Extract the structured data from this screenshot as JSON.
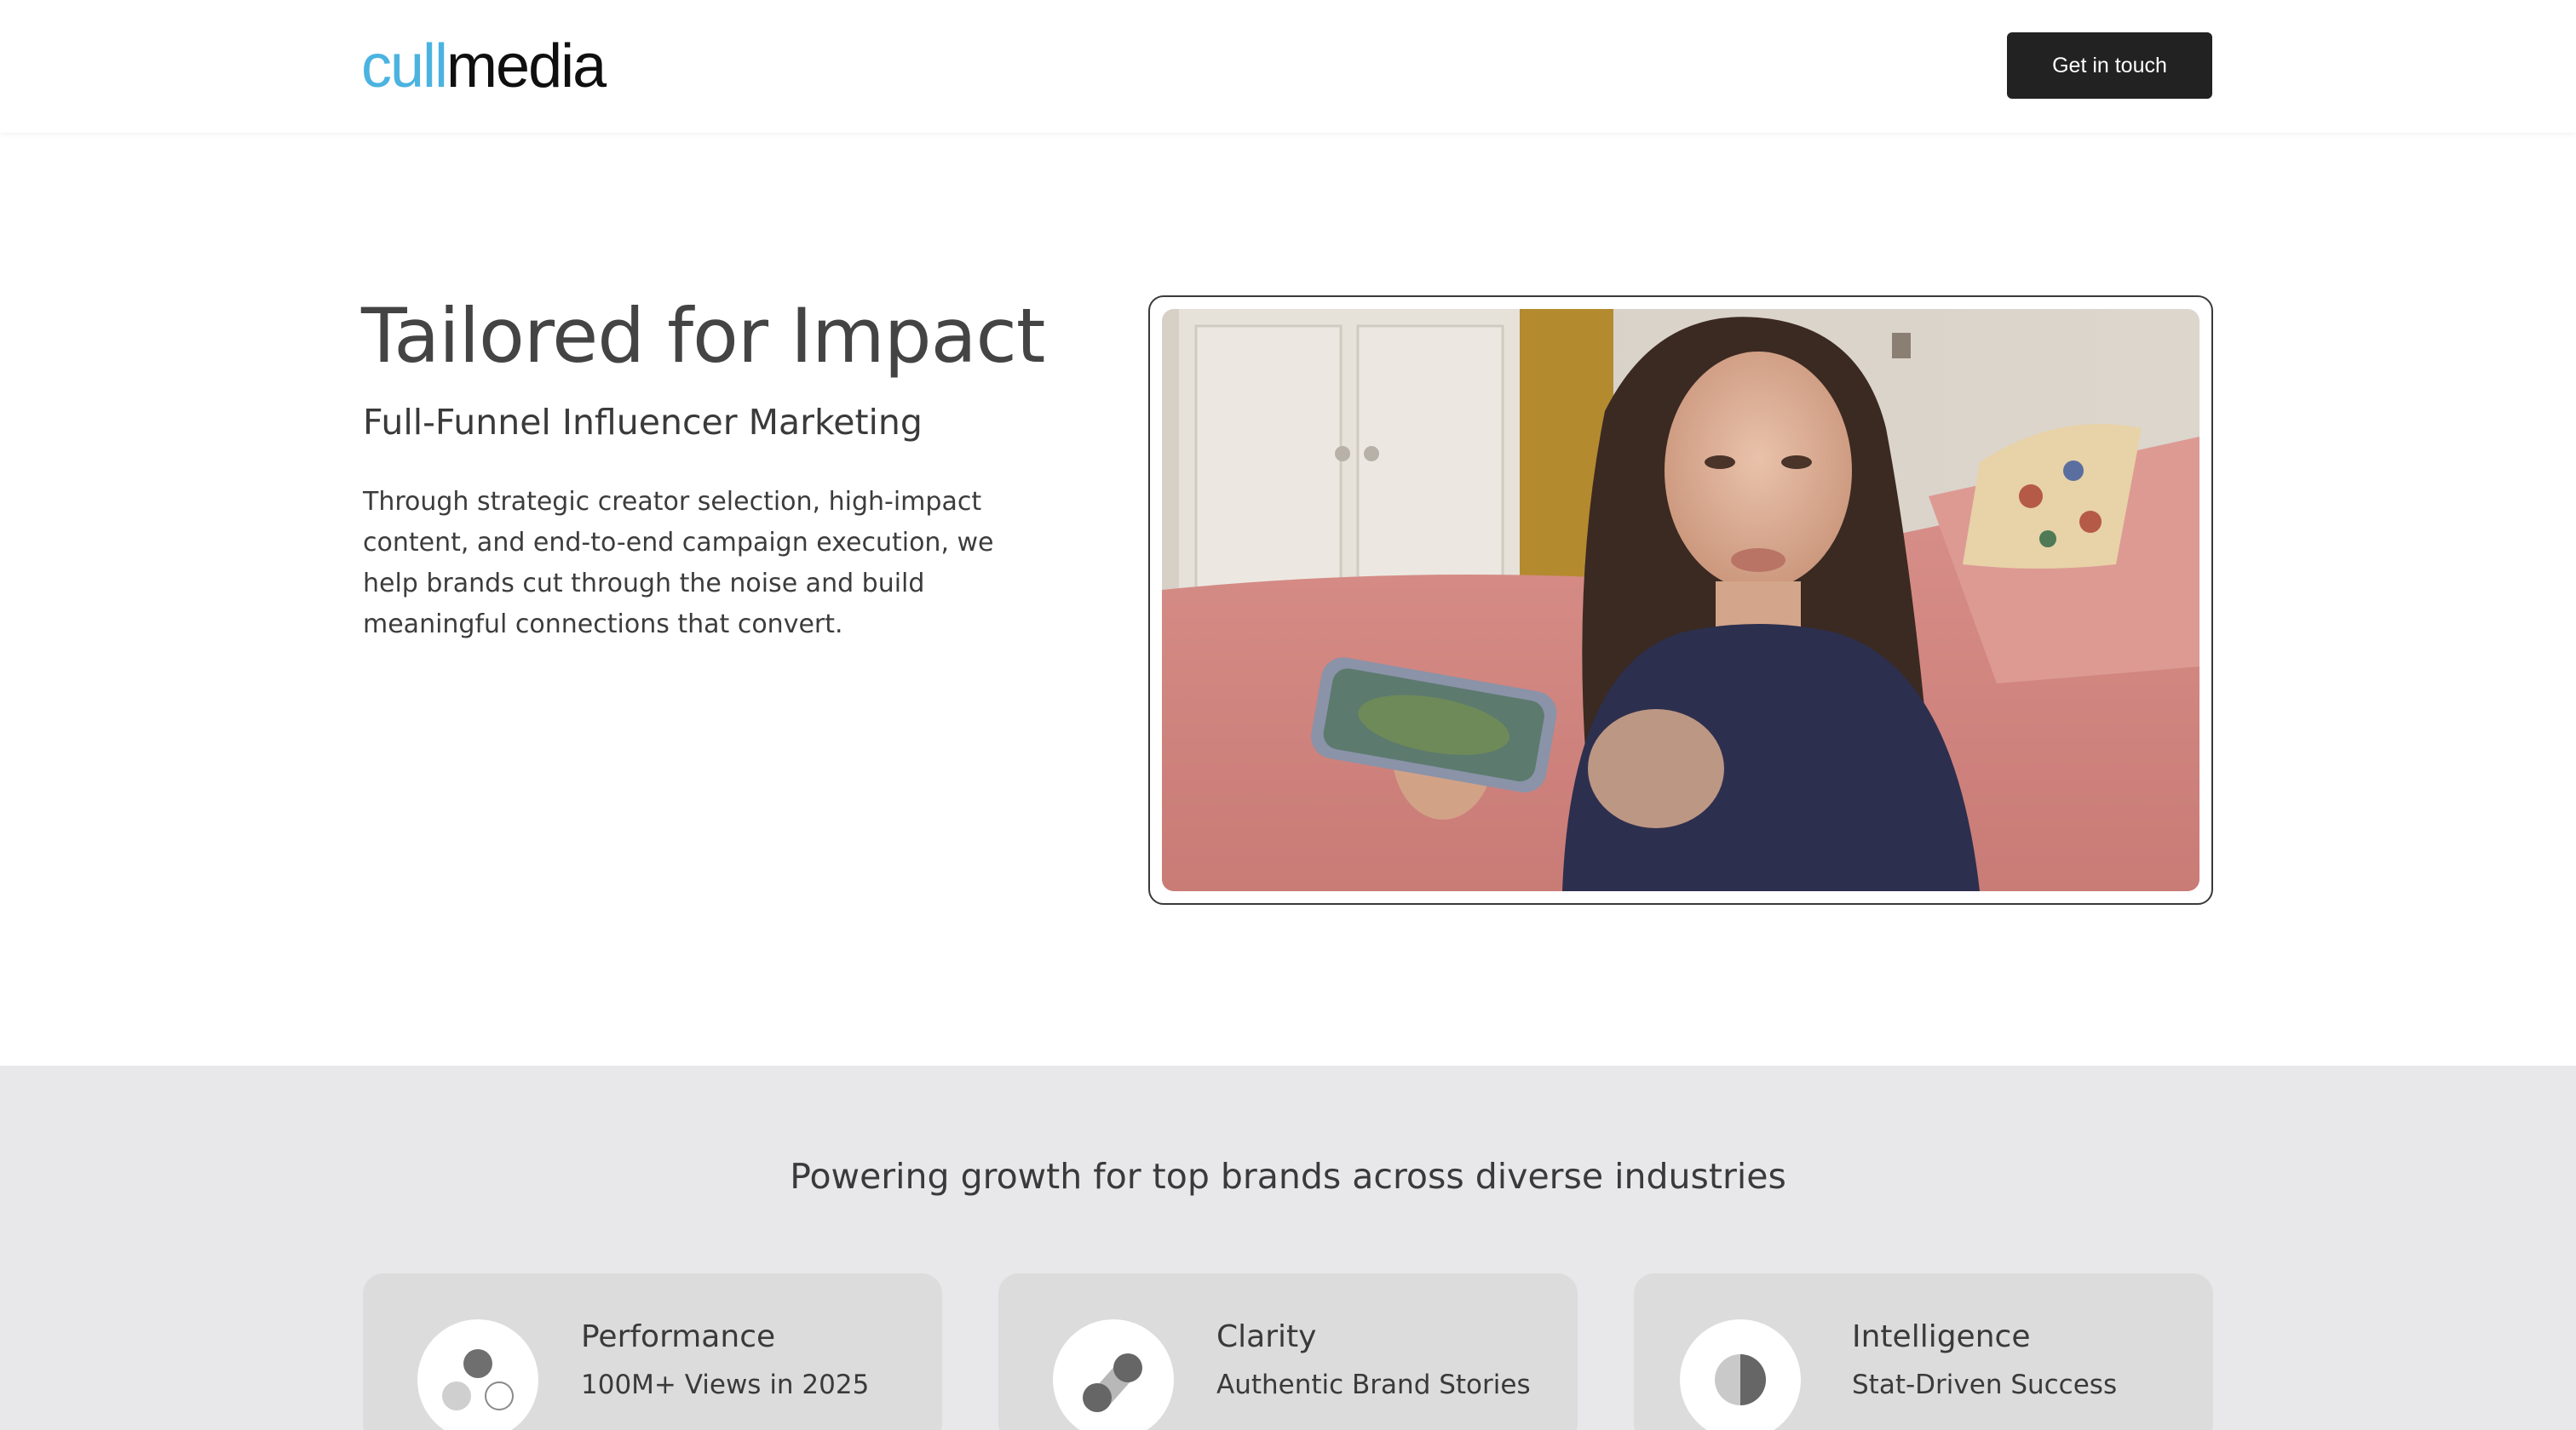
{
  "header": {
    "logo_part1": "cull",
    "logo_part2": "media",
    "cta_label": "Get in touch"
  },
  "hero": {
    "title": "Tailored for Impact",
    "subtitle": "Full-Funnel Influencer Marketing",
    "body": "Through strategic creator selection, high-impact content, and end-to-end campaign execution, we help brands cut through the noise and build meaningful connections that convert."
  },
  "stats": {
    "heading": "Powering growth for top brands across diverse industries",
    "cards": [
      {
        "title": "Performance",
        "subtitle": "100M+ Views in 2025",
        "icon": "three-dots-icon"
      },
      {
        "title": "Clarity",
        "subtitle": "Authentic Brand Stories",
        "icon": "connected-dots-icon"
      },
      {
        "title": "Intelligence",
        "subtitle": "Stat-Driven Success",
        "icon": "half-circle-icon"
      }
    ]
  },
  "colors": {
    "brand_blue": "#4bb3e0",
    "cta_bg": "#222222",
    "band_bg": "#e8e8ea",
    "card_bg": "#dcdcdc"
  }
}
